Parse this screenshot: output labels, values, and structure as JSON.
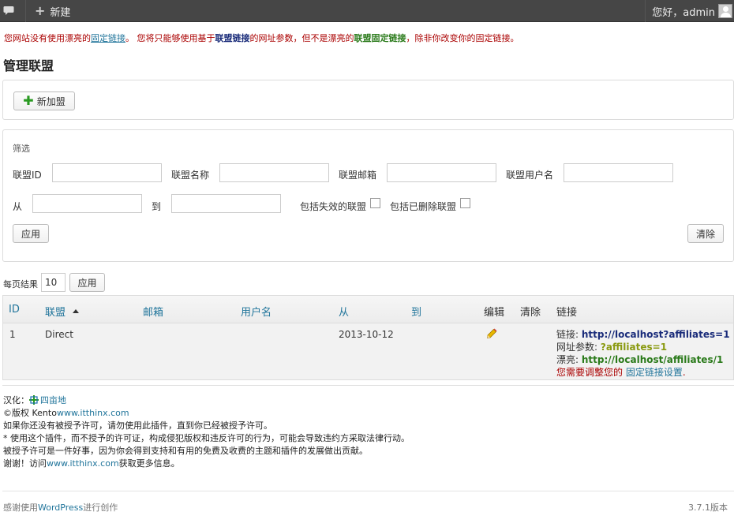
{
  "adminbar": {
    "comment_icon": "speech-bubble-icon",
    "new_label": "新建",
    "greeting": "您好，admin",
    "avatar_icon": "avatar-icon"
  },
  "notice": {
    "part1": "您网站没有使用漂亮的",
    "link1": "固定链接",
    "part2": "。 您将只能够使用基于",
    "bold1": "联盟链接",
    "part3": "的网址参数，但不是漂亮的",
    "bold2": "联盟固定链接",
    "part4": "，除非你改变你的固定链接。"
  },
  "page_title": "管理联盟",
  "add_button": "新加盟",
  "filter": {
    "title": "筛选",
    "label_id": "联盟ID",
    "label_name": "联盟名称",
    "label_email": "联盟邮箱",
    "label_username": "联盟用户名",
    "label_from": "从",
    "label_to": "到",
    "label_include_inactive": "包括失效的联盟",
    "label_include_deleted": "包括已删除联盟",
    "apply": "应用",
    "clear": "清除",
    "values": {
      "id": "",
      "name": "",
      "email": "",
      "username": "",
      "from": "",
      "to": ""
    }
  },
  "per_page": {
    "label": "每页结果",
    "value": "10",
    "apply": "应用"
  },
  "table": {
    "headers": {
      "id": "ID",
      "affiliate": "联盟",
      "email": "邮箱",
      "username": "用户名",
      "from": "从",
      "to": "到",
      "edit": "编辑",
      "clear": "清除",
      "links": "链接"
    },
    "rows": [
      {
        "id": "1",
        "affiliate": "Direct",
        "email": "",
        "username": "",
        "from": "2013-10-12",
        "to": "",
        "link_label": "链接: ",
        "link_value": "http://localhost?affiliates=1",
        "param_label": "网址参数: ",
        "param_value": "?affiliates=1",
        "pretty_label": "漂亮: ",
        "pretty_value": "http://localhost/affiliates/1",
        "pretty_note1": " 您需要调整您的 ",
        "pretty_note_link": "固定链接设置",
        "pretty_note2": "."
      }
    ]
  },
  "credits": {
    "translation_label": "汉化：",
    "translator": "四亩地",
    "copyright_prefix": "©版权 Kento",
    "copyright_link": "www.itthinx.com",
    "line3": "如果你还没有被授予许可，请勿使用此插件，直到你已经被授予许可。",
    "line4": "* 使用这个插件，而不授予的许可证，构成侵犯版权和违反许可的行为，可能会导致违约方采取法律行动。",
    "line5": "被授予许可是一件好事，因为你会得到支持和有用的免费及收费的主题和插件的发展做出贡献。",
    "line6_prefix": "谢谢！访问",
    "line6_link": "www.itthinx.com",
    "line6_suffix": "获取更多信息。"
  },
  "footer": {
    "left_prefix": "感谢使用",
    "left_link": "WordPress",
    "left_suffix": "进行创作",
    "version": "3.7.1版本"
  },
  "colors": {
    "adminbar_bg": "#464646",
    "link_blue": "#21759b",
    "notice_red": "#aa0000",
    "green": "#2a7a1a",
    "add_plus_green": "#2a9a22"
  }
}
